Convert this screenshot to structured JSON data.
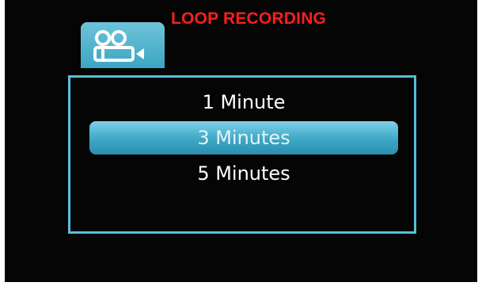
{
  "header": {
    "title": "LOOP RECORDING",
    "mode_icon": "video-camera-icon"
  },
  "menu": {
    "options": [
      {
        "label": "1 Minute",
        "selected": false
      },
      {
        "label": "3 Minutes",
        "selected": true
      },
      {
        "label": "5 Minutes",
        "selected": false
      }
    ]
  },
  "colors": {
    "title": "#ff1e1e",
    "accent": "#58bfd9",
    "background": "#050505",
    "text": "#ffffff"
  }
}
